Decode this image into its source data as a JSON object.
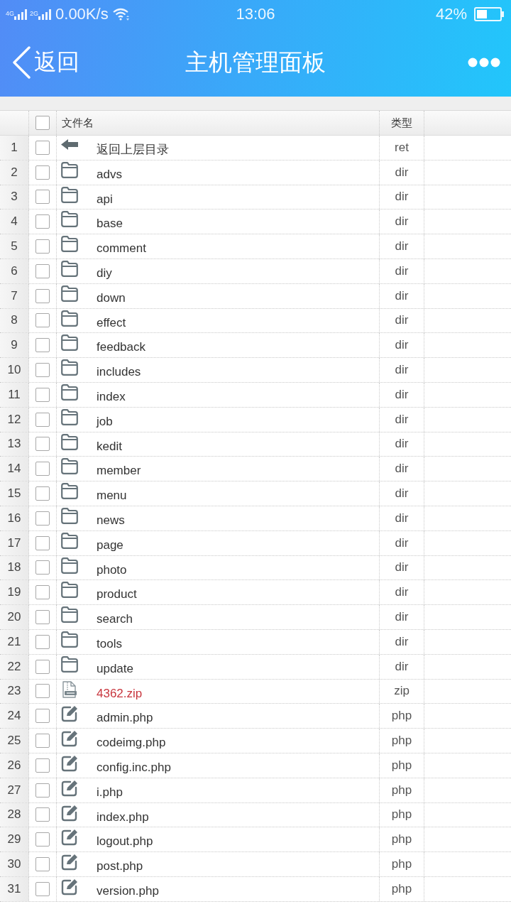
{
  "status_bar": {
    "signal_labels": [
      "4G",
      "2G"
    ],
    "speed": "0.00K/s",
    "time": "13:06",
    "battery": "42%"
  },
  "header": {
    "back": "返回",
    "title": "主机管理面板"
  },
  "table": {
    "header_checked": false,
    "columns": [
      "文件名",
      "类型"
    ],
    "rows": [
      {
        "number": "1",
        "checked": false,
        "kind": "parent",
        "name": "返回上层目录",
        "type": "ret"
      },
      {
        "number": "2",
        "checked": false,
        "kind": "dir",
        "name": "advs",
        "type": "dir"
      },
      {
        "number": "3",
        "checked": false,
        "kind": "dir",
        "name": "api",
        "type": "dir"
      },
      {
        "number": "4",
        "checked": false,
        "kind": "dir",
        "name": "base",
        "type": "dir"
      },
      {
        "number": "5",
        "checked": false,
        "kind": "dir",
        "name": "comment",
        "type": "dir"
      },
      {
        "number": "6",
        "checked": false,
        "kind": "dir",
        "name": "diy",
        "type": "dir"
      },
      {
        "number": "7",
        "checked": false,
        "kind": "dir",
        "name": "down",
        "type": "dir"
      },
      {
        "number": "8",
        "checked": false,
        "kind": "dir",
        "name": "effect",
        "type": "dir"
      },
      {
        "number": "9",
        "checked": false,
        "kind": "dir",
        "name": "feedback",
        "type": "dir"
      },
      {
        "number": "10",
        "checked": false,
        "kind": "dir",
        "name": "includes",
        "type": "dir"
      },
      {
        "number": "11",
        "checked": false,
        "kind": "dir",
        "name": "index",
        "type": "dir"
      },
      {
        "number": "12",
        "checked": false,
        "kind": "dir",
        "name": "job",
        "type": "dir"
      },
      {
        "number": "13",
        "checked": false,
        "kind": "dir",
        "name": "kedit",
        "type": "dir"
      },
      {
        "number": "14",
        "checked": false,
        "kind": "dir",
        "name": "member",
        "type": "dir"
      },
      {
        "number": "15",
        "checked": false,
        "kind": "dir",
        "name": "menu",
        "type": "dir"
      },
      {
        "number": "16",
        "checked": false,
        "kind": "dir",
        "name": "news",
        "type": "dir"
      },
      {
        "number": "17",
        "checked": false,
        "kind": "dir",
        "name": "page",
        "type": "dir"
      },
      {
        "number": "18",
        "checked": false,
        "kind": "dir",
        "name": "photo",
        "type": "dir"
      },
      {
        "number": "19",
        "checked": false,
        "kind": "dir",
        "name": "product",
        "type": "dir"
      },
      {
        "number": "20",
        "checked": false,
        "kind": "dir",
        "name": "search",
        "type": "dir"
      },
      {
        "number": "21",
        "checked": false,
        "kind": "dir",
        "name": "tools",
        "type": "dir"
      },
      {
        "number": "22",
        "checked": false,
        "kind": "dir",
        "name": "update",
        "type": "dir"
      },
      {
        "number": "23",
        "checked": false,
        "kind": "archive",
        "name": "4362.zip",
        "type": "zip"
      },
      {
        "number": "24",
        "checked": false,
        "kind": "script",
        "name": "admin.php",
        "type": "php"
      },
      {
        "number": "25",
        "checked": false,
        "kind": "script",
        "name": "codeimg.php",
        "type": "php"
      },
      {
        "number": "26",
        "checked": false,
        "kind": "script",
        "name": "config.inc.php",
        "type": "php"
      },
      {
        "number": "27",
        "checked": false,
        "kind": "script",
        "name": "i.php",
        "type": "php"
      },
      {
        "number": "28",
        "checked": false,
        "kind": "script",
        "name": "index.php",
        "type": "php"
      },
      {
        "number": "29",
        "checked": false,
        "kind": "script",
        "name": "logout.php",
        "type": "php"
      },
      {
        "number": "30",
        "checked": false,
        "kind": "script",
        "name": "post.php",
        "type": "php"
      },
      {
        "number": "31",
        "checked": false,
        "kind": "script",
        "name": "version.php",
        "type": "php"
      }
    ]
  }
}
